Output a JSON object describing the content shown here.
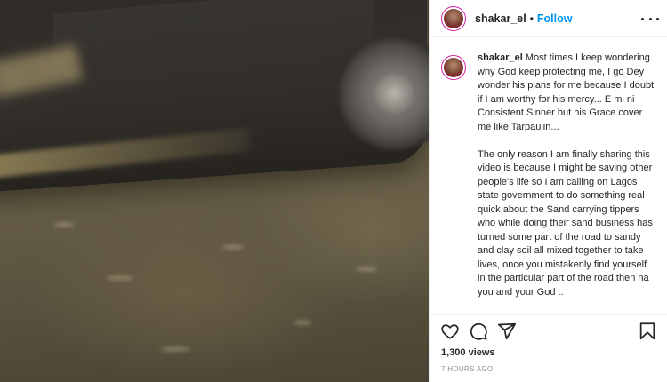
{
  "post": {
    "username": "shakar_el",
    "separator": "•",
    "follow_label": "Follow",
    "more_icon": "more-horizontal-icon",
    "caption": "Most times I keep wondering why God keep protecting me, I go Dey wonder his plans for me because I doubt if I am worthy for his mercy... E mi ni Consistent Sinner but his Grace cover me like Tarpaulin...\n\nThe only reason I am finally sharing this video is because I might be saving other people's life so I am calling on Lagos state government to do something real quick about the Sand carrying tippers who while doing their sand business has turned some part of the road to sandy and clay soil all mixed together to take lives, once you mistakenly find yourself in the particular part of the road then na you and your God ..",
    "views": "1,300 views",
    "timestamp": "7 HOURS AGO"
  },
  "icons": {
    "like": "heart-icon",
    "comment": "comment-icon",
    "share": "share-icon",
    "save": "bookmark-icon"
  },
  "colors": {
    "link": "#0095f6",
    "text": "#262626",
    "muted": "#8e8e8e",
    "avatar_ring": "#d6249f"
  }
}
